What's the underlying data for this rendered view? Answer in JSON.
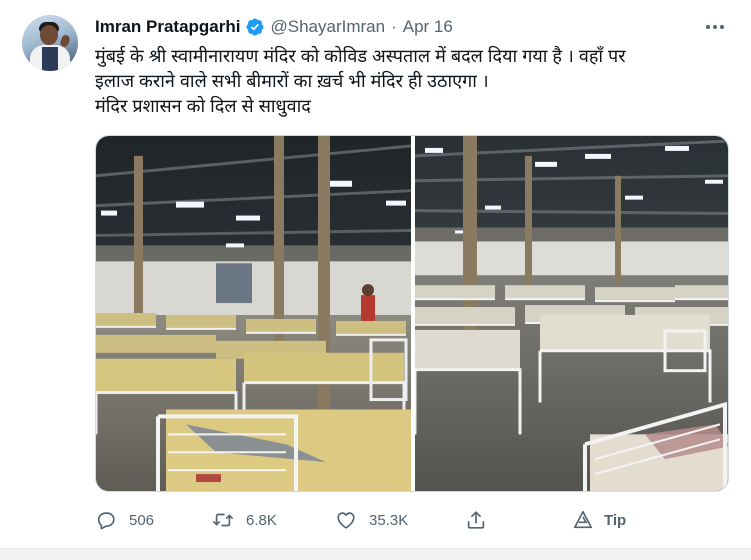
{
  "tweet": {
    "author_name": "Imran Pratapgarhi",
    "author_handle": "@ShayarImran",
    "separator": "·",
    "date": "Apr 16",
    "text_lines": [
      "मुंबई के श्री स्वामीनारायण मंदिर को कोविड अस्पताल में बदल दिया गया है । वहाँ पर",
      "इलाज कराने वाले सभी बीमारों का ख़र्च भी मंदिर ही उठाएगा ।",
      "मंदिर प्रशासन को दिल से साधुवाद"
    ],
    "media": [
      {
        "icon": "hospital-ward-photo"
      },
      {
        "icon": "hospital-ward-photo"
      }
    ]
  },
  "actions": {
    "reply_count": "506",
    "retweet_count": "6.8K",
    "like_count": "35.3K",
    "tip_label": "Tip"
  },
  "colors": {
    "text": "#0f1419",
    "muted": "#536471",
    "verified": "#1d9bf0",
    "bed_sheet": "#d8c87e",
    "bed_frame": "#f2f2f2"
  }
}
